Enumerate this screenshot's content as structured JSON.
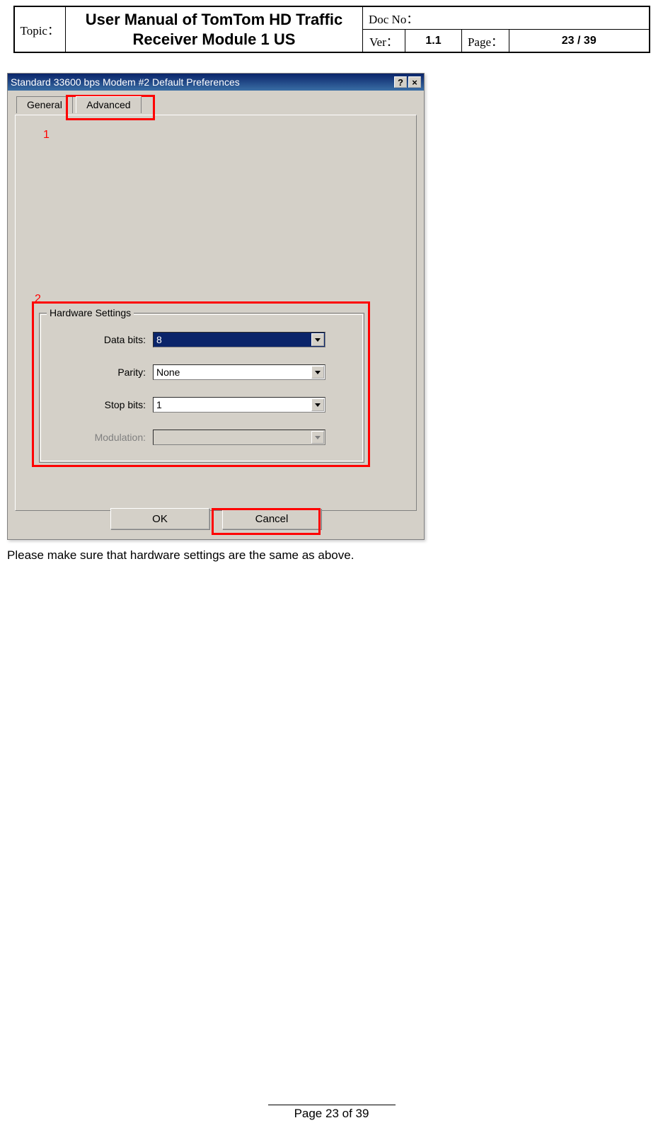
{
  "header": {
    "topic_label": "Topic：",
    "title": "User Manual of TomTom HD Traffic Receiver Module 1 US",
    "docno_label": "Doc No：",
    "docno_value": "",
    "ver_label": "Ver：",
    "ver_value": "1.1",
    "page_label": "Page：",
    "page_value": "23 / 39"
  },
  "dialog": {
    "title": "Standard 33600 bps Modem #2 Default Preferences",
    "help_btn": "?",
    "close_btn": "×",
    "tabs": {
      "general": "General",
      "advanced": "Advanced"
    },
    "group_label": "Hardware Settings",
    "fields": {
      "databits_label": "Data bits:",
      "databits_value": "8",
      "parity_label": "Parity:",
      "parity_value": "None",
      "stopbits_label": "Stop bits:",
      "stopbits_value": "1",
      "modulation_label": "Modulation:",
      "modulation_value": ""
    },
    "ok": "OK",
    "cancel": "Cancel"
  },
  "annotations": {
    "one": "1",
    "two": "2"
  },
  "body_text": "Please make sure that hardware settings are the same as above.",
  "footer": "Page 23 of 39"
}
